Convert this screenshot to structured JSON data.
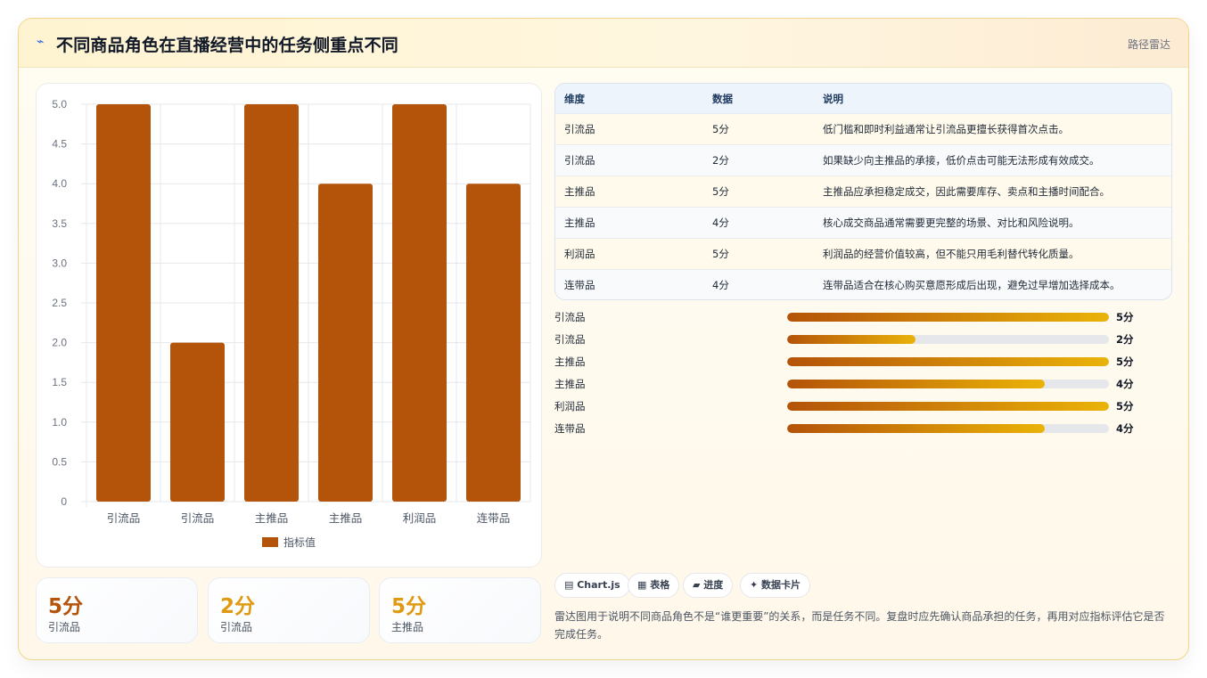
{
  "header": {
    "icon": "chart-line-icon",
    "icon_glyph": "⌁",
    "title": "不同商品角色在直播经营中的任务侧重点不同",
    "tag": "路径雷达"
  },
  "colors": {
    "bar": "#b4540a",
    "accent_orange": "#b45309",
    "accent_amber": "#e09a12",
    "progress_start": "#b45309",
    "progress_end": "#eab308"
  },
  "chart_data": {
    "type": "bar",
    "categories": [
      "引流品",
      "引流品",
      "主推品",
      "主推品",
      "利润品",
      "连带品"
    ],
    "series": [
      {
        "name": "指标值",
        "values": [
          5,
          2,
          5,
          4,
          5,
          4
        ]
      }
    ],
    "ylim": [
      0,
      5
    ],
    "yticks": [
      "0",
      "0.5",
      "1.0",
      "1.5",
      "2.0",
      "2.5",
      "3.0",
      "3.5",
      "4.0",
      "4.5",
      "5.0"
    ],
    "grid": true,
    "legend": "bottom"
  },
  "stats": [
    {
      "value": "5分",
      "label": "引流品",
      "color": "#b45309"
    },
    {
      "value": "2分",
      "label": "引流品",
      "color": "#e09a12"
    },
    {
      "value": "5分",
      "label": "主推品",
      "color": "#e09a12"
    }
  ],
  "table": {
    "headers": [
      "维度",
      "数据",
      "说明"
    ],
    "rows": [
      [
        "引流品",
        "5分",
        "低门槛和即时利益通常让引流品更擅长获得首次点击。"
      ],
      [
        "引流品",
        "2分",
        "如果缺少向主推品的承接，低价点击可能无法形成有效成交。"
      ],
      [
        "主推品",
        "5分",
        "主推品应承担稳定成交，因此需要库存、卖点和主播时间配合。"
      ],
      [
        "主推品",
        "4分",
        "核心成交商品通常需要更完整的场景、对比和风险说明。"
      ],
      [
        "利润品",
        "5分",
        "利润品的经营价值较高，但不能只用毛利替代转化质量。"
      ],
      [
        "连带品",
        "4分",
        "连带品适合在核心购买意愿形成后出现，避免过早增加选择成本。"
      ]
    ]
  },
  "progress": {
    "max": 5,
    "items": [
      {
        "label": "引流品",
        "value": 5,
        "text": "5分"
      },
      {
        "label": "引流品",
        "value": 2,
        "text": "2分"
      },
      {
        "label": "主推品",
        "value": 5,
        "text": "5分"
      },
      {
        "label": "主推品",
        "value": 4,
        "text": "4分"
      },
      {
        "label": "利润品",
        "value": 5,
        "text": "5分"
      },
      {
        "label": "连带品",
        "value": 4,
        "text": "4分"
      }
    ]
  },
  "chips": [
    {
      "icon": "chart-icon",
      "label": "▤ Chart.js"
    },
    {
      "icon": "table-icon",
      "label": "▦ 表格"
    },
    {
      "icon": "progress-icon",
      "label": "▰ 进度"
    },
    {
      "icon": "spark-icon",
      "label": "✦ 数据卡片"
    }
  ],
  "note": "雷达图用于说明不同商品角色不是“谁更重要”的关系，而是任务不同。复盘时应先确认商品承担的任务，再用对应指标评估它是否完成任务。"
}
